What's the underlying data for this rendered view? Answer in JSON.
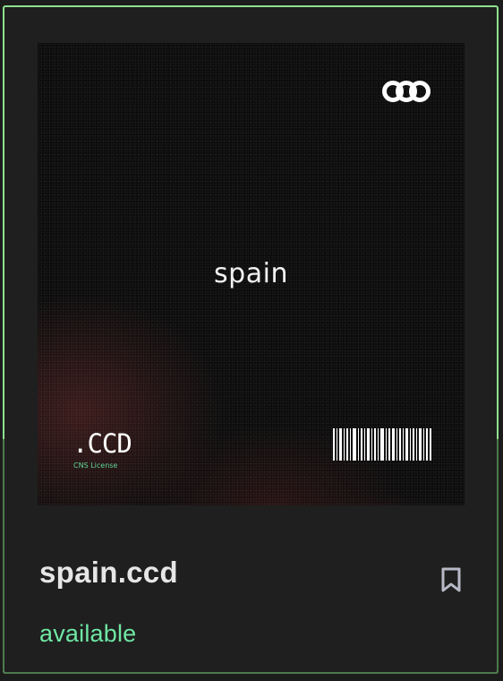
{
  "card": {
    "artwork": {
      "domain_label": "spain",
      "tld": ".CCD",
      "license_text": "CNS License",
      "logo_icon": "interlocked-rings-icon",
      "barcode_icon": "barcode-icon"
    },
    "domain_name": "spain.ccd",
    "status": "available",
    "bookmark_icon": "bookmark-icon"
  },
  "colors": {
    "border_accent": "#8fe08f",
    "status_green": "#6ee7a3",
    "license_green": "#5fd495",
    "card_bg": "#1f1f1f",
    "art_bg": "#0c0c0c"
  }
}
